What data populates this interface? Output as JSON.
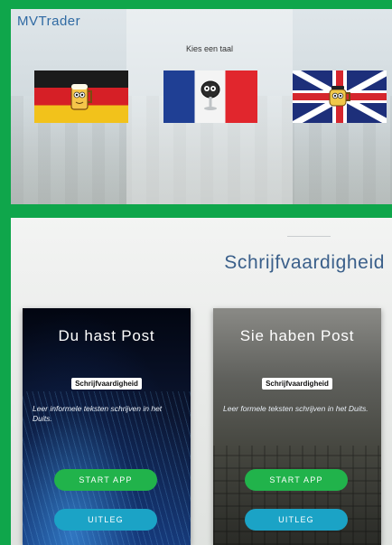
{
  "language_panel": {
    "brand": "MVTrader",
    "prompt": "Kies een taal",
    "flags": [
      {
        "name": "german-flag",
        "icon": "german-flag-with-beer-mascot"
      },
      {
        "name": "french-flag",
        "icon": "french-flag-with-wine-glass-mascot"
      },
      {
        "name": "british-flag",
        "icon": "british-flag-with-tea-cup-mascot"
      }
    ]
  },
  "skills_section": {
    "title": "Schrijfvaardigheid",
    "cards": [
      {
        "title": "Du hast Post",
        "badge": "Schrijfvaardigheid",
        "description": "Leer informele teksten schrijven in het Duits.",
        "start_label": "START APP",
        "info_label": "UITLEG"
      },
      {
        "title": "Sie haben Post",
        "badge": "Schrijfvaardigheid",
        "description": "Leer formele teksten schrijven in het Duits.",
        "start_label": "START APP",
        "info_label": "UITLEG"
      }
    ]
  },
  "colors": {
    "background_green": "#0fa64b",
    "brand_blue": "#2f6aa3",
    "start_button": "#21b34b",
    "info_button": "#1ba3c6"
  }
}
